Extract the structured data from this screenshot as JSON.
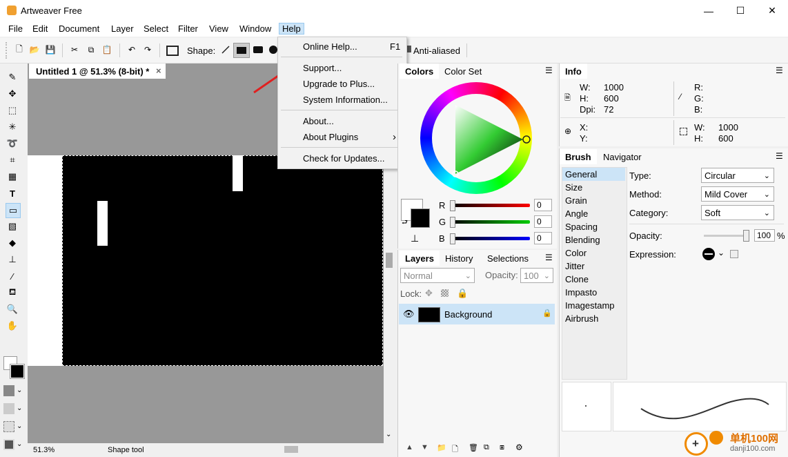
{
  "app": {
    "title": "Artweaver Free"
  },
  "window_buttons": {
    "minimize": "—",
    "maximize": "☐",
    "close": "✕"
  },
  "menubar": [
    "File",
    "Edit",
    "Document",
    "Layer",
    "Select",
    "Filter",
    "View",
    "Window",
    "Help"
  ],
  "toolbar": {
    "shape_label": "Shape:",
    "anti_aliased": "Anti-aliased"
  },
  "document": {
    "tab_title": "Untitled 1 @ 51.3% (8-bit) *",
    "close": "×"
  },
  "status": {
    "zoom": "51.3%",
    "tool": "Shape tool"
  },
  "help_menu": {
    "items": [
      {
        "label": "Online Help...",
        "shortcut": "F1"
      },
      {
        "label": "Support...",
        "shortcut": ""
      },
      {
        "label": "Upgrade to Plus...",
        "shortcut": ""
      },
      {
        "label": "System Information...",
        "shortcut": ""
      },
      {
        "label": "About...",
        "shortcut": ""
      },
      {
        "label": "About Plugins",
        "shortcut": "›"
      },
      {
        "label": "Check for Updates...",
        "shortcut": ""
      }
    ]
  },
  "colors_panel": {
    "tabs": [
      "Colors",
      "Color Set"
    ],
    "r_label": "R",
    "g_label": "G",
    "b_label": "B",
    "r_value": "0",
    "g_value": "0",
    "b_value": "0"
  },
  "layers_panel": {
    "tabs": [
      "Layers",
      "History",
      "Selections"
    ],
    "blend_mode": "Normal",
    "opacity_label": "Opacity:",
    "opacity_value": "100",
    "lock_label": "Lock:",
    "layer_name": "Background"
  },
  "info_panel": {
    "title": "Info",
    "w_label": "W:",
    "w_value": "1000",
    "h_label": "H:",
    "h_value": "600",
    "dpi_label": "Dpi:",
    "dpi_value": "72",
    "r_label": "R:",
    "g_label": "G:",
    "b_label": "B:",
    "x_label": "X:",
    "y_label": "Y:",
    "sel_w_label": "W:",
    "sel_w_value": "1000",
    "sel_h_label": "H:",
    "sel_h_value": "600"
  },
  "brush_panel": {
    "tabs": [
      "Brush",
      "Navigator"
    ],
    "categories": [
      "General",
      "Size",
      "Grain",
      "Angle",
      "Spacing",
      "Blending",
      "Color",
      "Jitter",
      "Clone",
      "Impasto",
      "Imagestamp",
      "Airbrush"
    ],
    "type_label": "Type:",
    "type_value": "Circular",
    "method_label": "Method:",
    "method_value": "Mild Cover",
    "category_label": "Category:",
    "category_value": "Soft",
    "opacity_label": "Opacity:",
    "opacity_value": "100",
    "opacity_unit": "%",
    "expression_label": "Expression:"
  },
  "watermark": {
    "brand": "单机100网",
    "url": "danji100.com"
  }
}
